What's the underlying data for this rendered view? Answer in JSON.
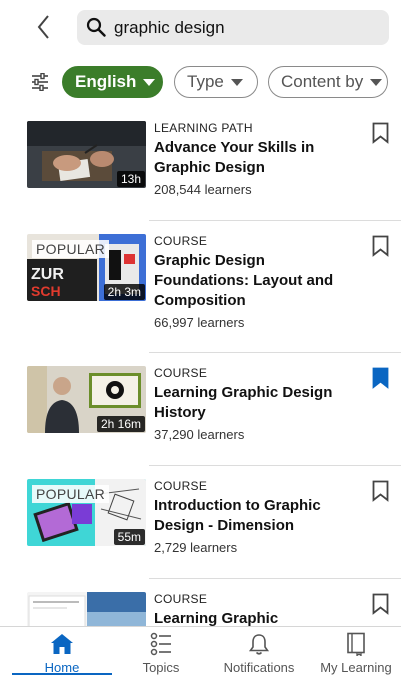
{
  "search": {
    "query": "graphic design"
  },
  "filters": [
    {
      "label": "English",
      "active": true
    },
    {
      "label": "Type",
      "active": false
    },
    {
      "label": "Content by",
      "active": false
    }
  ],
  "items": [
    {
      "type": "LEARNING PATH",
      "title": "Advance Your Skills in Graphic Design",
      "learners": "208,544 learners",
      "duration": "13h",
      "badge": "",
      "saved": false
    },
    {
      "type": "COURSE",
      "title": "Graphic Design Foundations: Layout and Composition",
      "learners": "66,997 learners",
      "duration": "2h 3m",
      "badge": "POPULAR",
      "saved": false
    },
    {
      "type": "COURSE",
      "title": "Learning Graphic Design History",
      "learners": "37,290 learners",
      "duration": "2h 16m",
      "badge": "",
      "saved": true
    },
    {
      "type": "COURSE",
      "title": "Introduction to Graphic Design - Dimension",
      "learners": "2,729 learners",
      "duration": "55m",
      "badge": "POPULAR",
      "saved": false
    },
    {
      "type": "COURSE",
      "title": "Learning Graphic",
      "learners": "",
      "duration": "",
      "badge": "",
      "saved": false
    }
  ],
  "tabs": [
    {
      "label": "Home",
      "icon": "home-icon",
      "active": true
    },
    {
      "label": "Topics",
      "icon": "topics-list-icon",
      "active": false
    },
    {
      "label": "Notifications",
      "icon": "bell-icon",
      "active": false
    },
    {
      "label": "My Learning",
      "icon": "book-icon",
      "active": false
    }
  ],
  "colors": {
    "accent": "#0a66c2",
    "filter_active": "#3b7d2a"
  }
}
